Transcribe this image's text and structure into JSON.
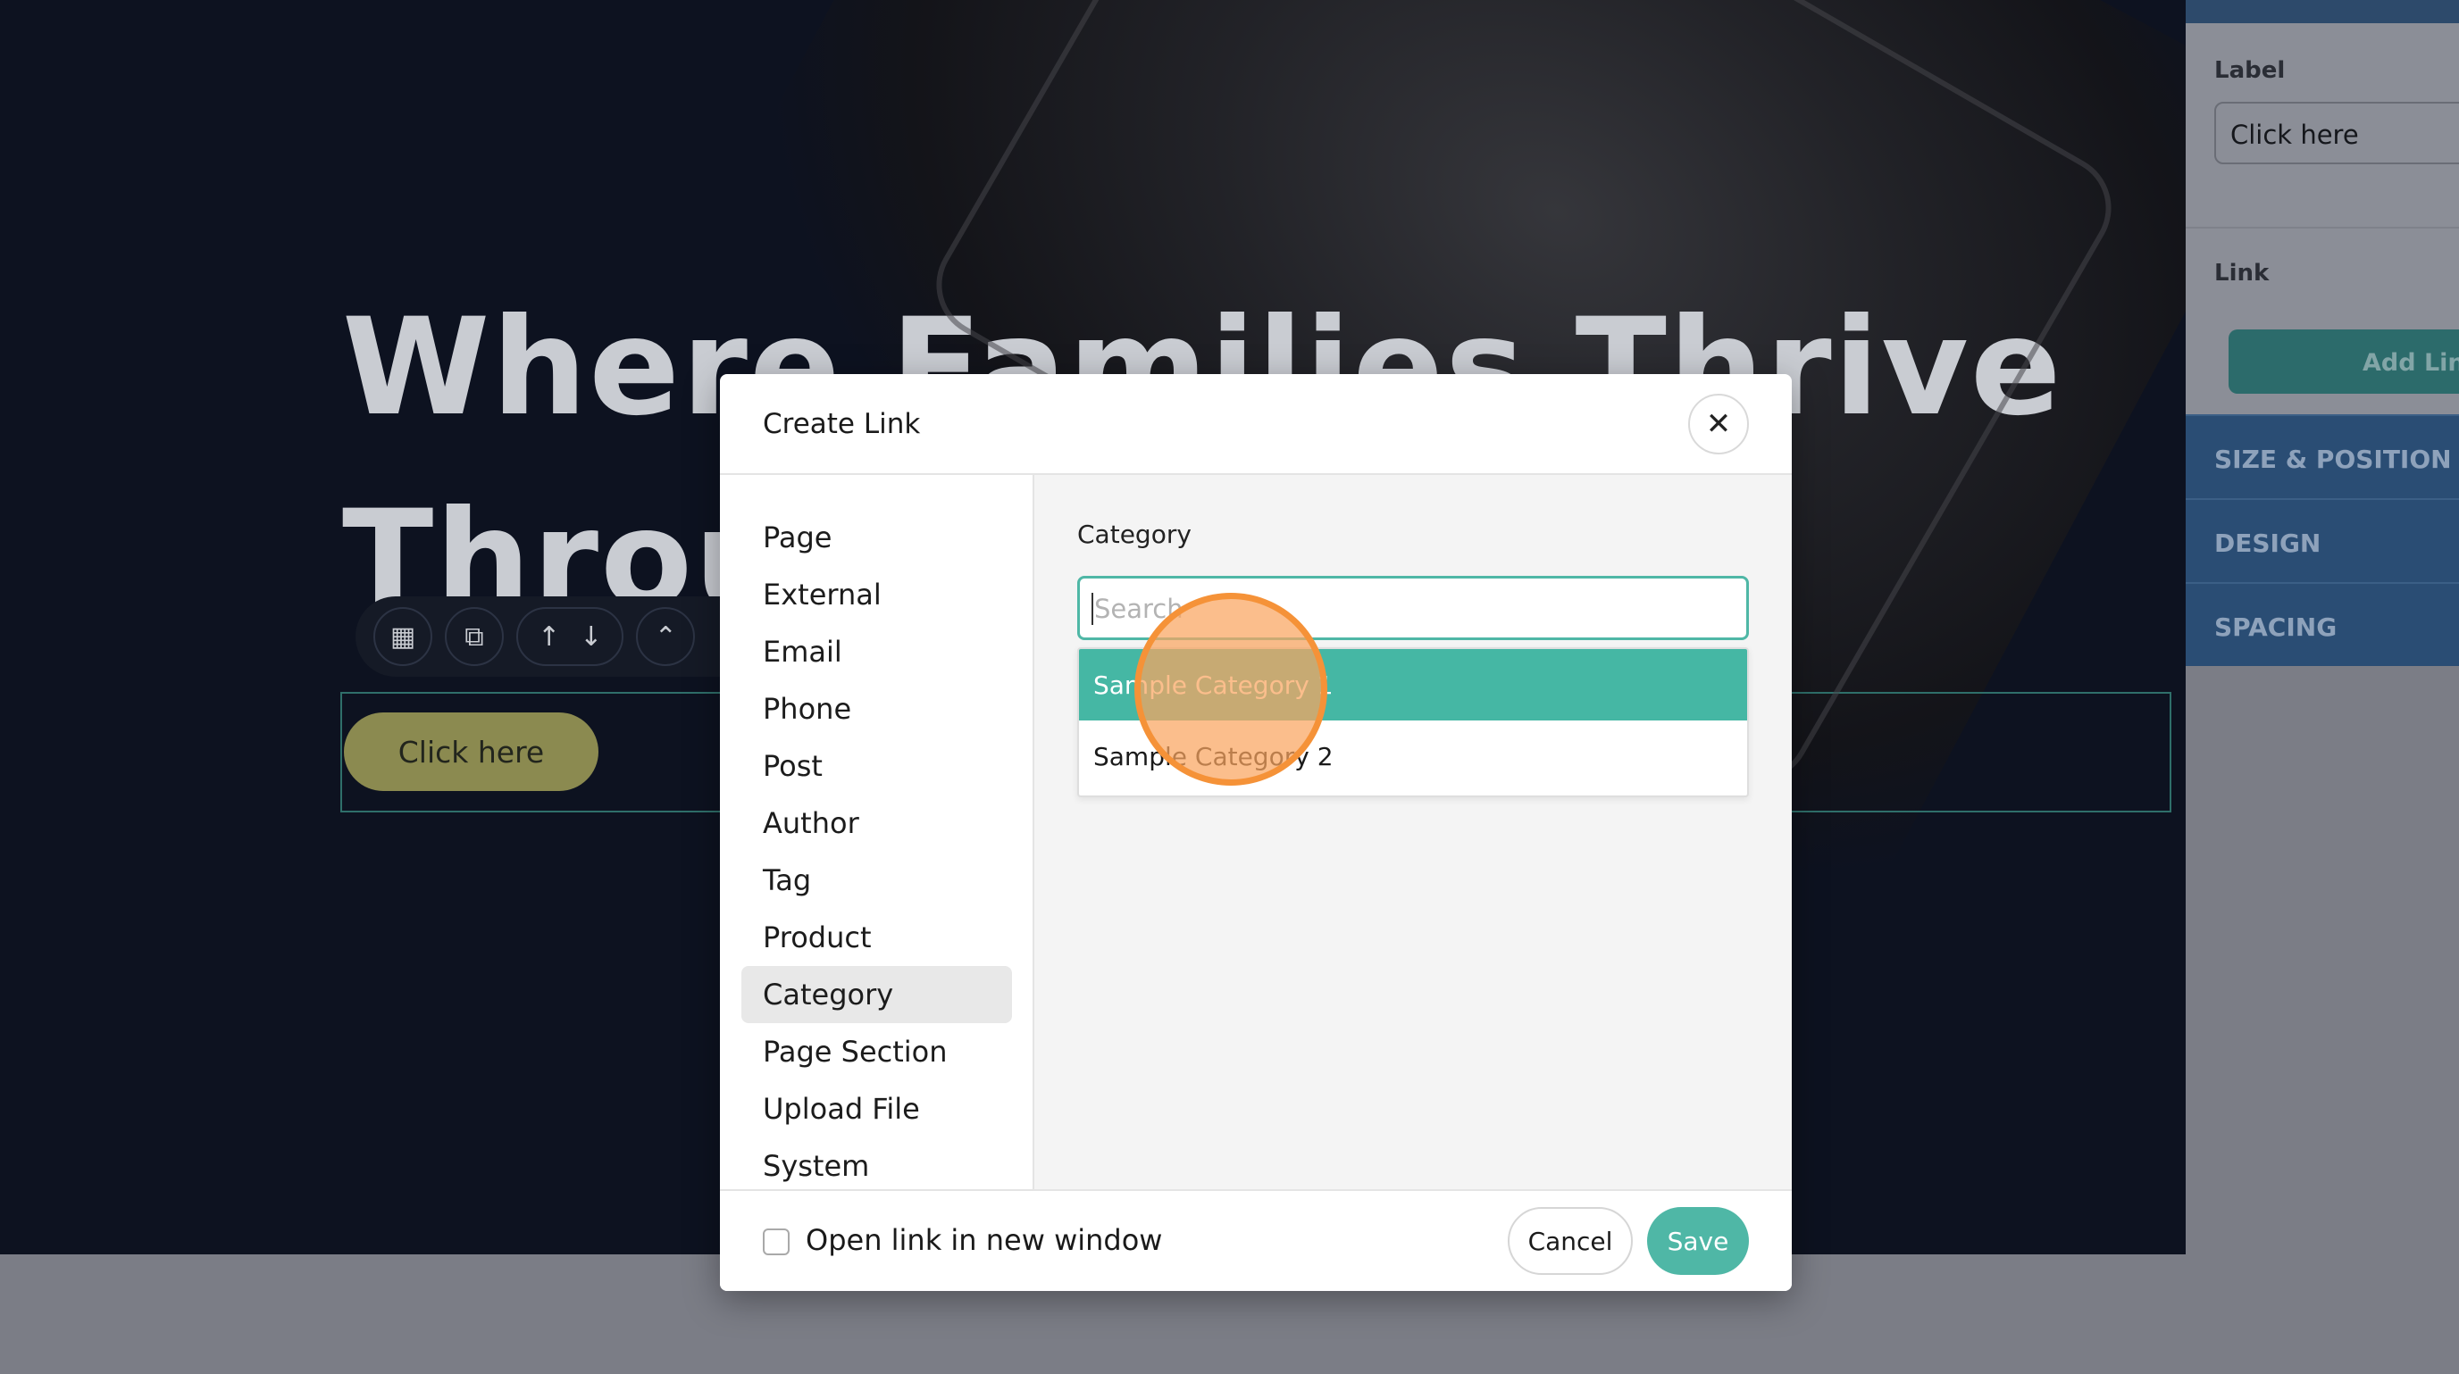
{
  "hero": {
    "line1": "Where Families Thrive",
    "line2": "Throu"
  },
  "canvas": {
    "button_label": "Click here"
  },
  "toolbar": {
    "icons": [
      "grid-icon",
      "copy-icon",
      "arrow-up-icon",
      "arrow-down-icon",
      "chevrons-up-icon"
    ]
  },
  "sidebar": {
    "label_heading": "Label",
    "label_value": "Click here",
    "link_heading": "Link",
    "add_link": "Add Link",
    "sections": [
      "SIZE & POSITION",
      "DESIGN",
      "SPACING"
    ]
  },
  "modal": {
    "title": "Create Link",
    "nav": [
      "Page",
      "External",
      "Email",
      "Phone",
      "Post",
      "Author",
      "Tag",
      "Product",
      "Category",
      "Page Section",
      "Upload File",
      "System"
    ],
    "active_nav": "Category",
    "content_label": "Category",
    "search_placeholder": "Search",
    "options": [
      "Sample Category 1",
      "Sample Category 2"
    ],
    "open_new_window": "Open link in new window",
    "cancel": "Cancel",
    "save": "Save"
  },
  "colors": {
    "accent": "#4fb7a6",
    "highlight": "#45b7a4",
    "click_marker": "#f59238"
  }
}
